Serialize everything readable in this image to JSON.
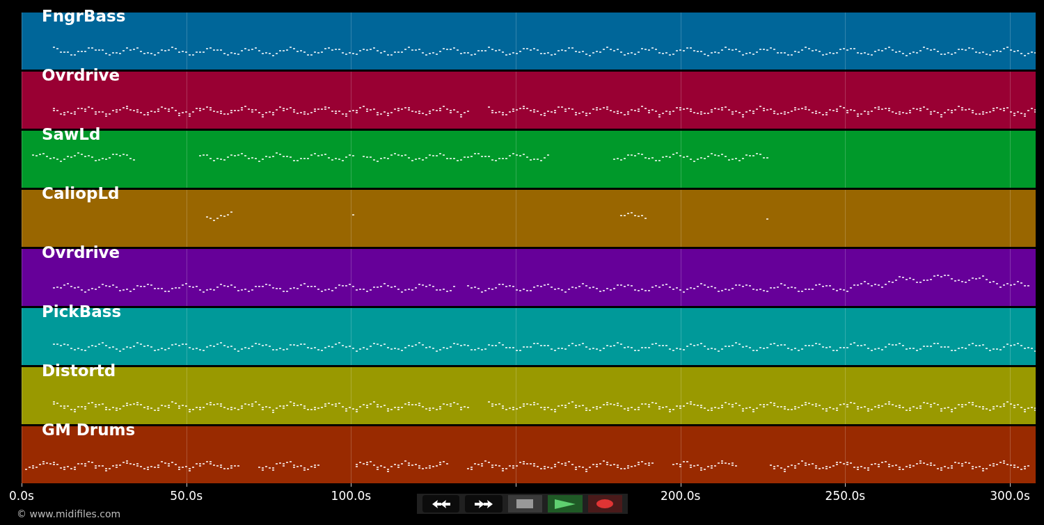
{
  "tracks": [
    {
      "name": "FngrBass",
      "color": "#006699"
    },
    {
      "name": "Ovrdrive",
      "color": "#990033"
    },
    {
      "name": "SawLd",
      "color": "#00992a"
    },
    {
      "name": "CaliopLd",
      "color": "#996600"
    },
    {
      "name": "Ovrdrive",
      "color": "#660099"
    },
    {
      "name": "PickBass",
      "color": "#009999"
    },
    {
      "name": "Distortd",
      "color": "#999900"
    },
    {
      "name": "GM Drums",
      "color": "#992a00"
    }
  ],
  "axis": {
    "ticks": [
      "0.0s",
      "50.0s",
      "100.0s",
      "200.0s",
      "250.0s",
      "300.0s"
    ]
  },
  "copyright": "© www.midifiles.com"
}
